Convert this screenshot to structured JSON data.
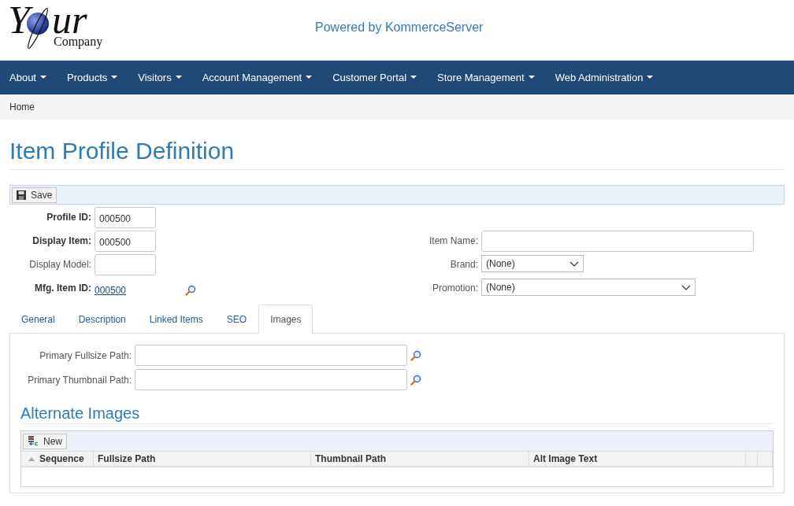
{
  "header": {
    "logo": {
      "first": "Y",
      "rest": "ur",
      "company": "Company"
    },
    "powered_by": "Powered by KommerceServer"
  },
  "nav": {
    "items": [
      {
        "label": "About"
      },
      {
        "label": "Products"
      },
      {
        "label": "Visitors"
      },
      {
        "label": "Account Management"
      },
      {
        "label": "Customer Portal"
      },
      {
        "label": "Store Management"
      },
      {
        "label": "Web Administration"
      }
    ]
  },
  "breadcrumb": [
    "Home"
  ],
  "page_title": "Item Profile Definition",
  "toolbar": {
    "buttons": [
      "Save"
    ]
  },
  "form": {
    "left": [
      {
        "label": "Profile ID:",
        "bold": true,
        "kind": "input",
        "value": "000500"
      },
      {
        "label": "Display Item:",
        "bold": true,
        "kind": "input",
        "value": "000500"
      },
      {
        "label": "Display Model:",
        "bold": false,
        "kind": "input"
      },
      {
        "label": "Mfg. Item ID:",
        "bold": true,
        "kind": "link",
        "value": "000500"
      }
    ],
    "right": [
      {
        "label": "Item Name:",
        "kind": "input"
      },
      {
        "label": "Brand:",
        "kind": "select",
        "value": "(None)"
      },
      {
        "label": "Promotion:",
        "kind": "select",
        "value": "(None)"
      }
    ]
  },
  "tabs": [
    {
      "label": "General",
      "selected": false
    },
    {
      "label": "Description",
      "selected": false
    },
    {
      "label": "Linked Items",
      "selected": false
    },
    {
      "label": "SEO",
      "selected": false
    },
    {
      "label": "Images",
      "selected": true
    }
  ],
  "images": {
    "paths": [
      {
        "label": "Primary Fullsize Path:"
      },
      {
        "label": "Primary Thumbnail Path:"
      }
    ],
    "section_title": "Alternate Images",
    "grid": {
      "toolbar_buttons": [
        "New"
      ],
      "columns": [
        "Sequence",
        "Fullsize Path",
        "Thumbnail Path",
        "Alt Image Text"
      ]
    }
  }
}
